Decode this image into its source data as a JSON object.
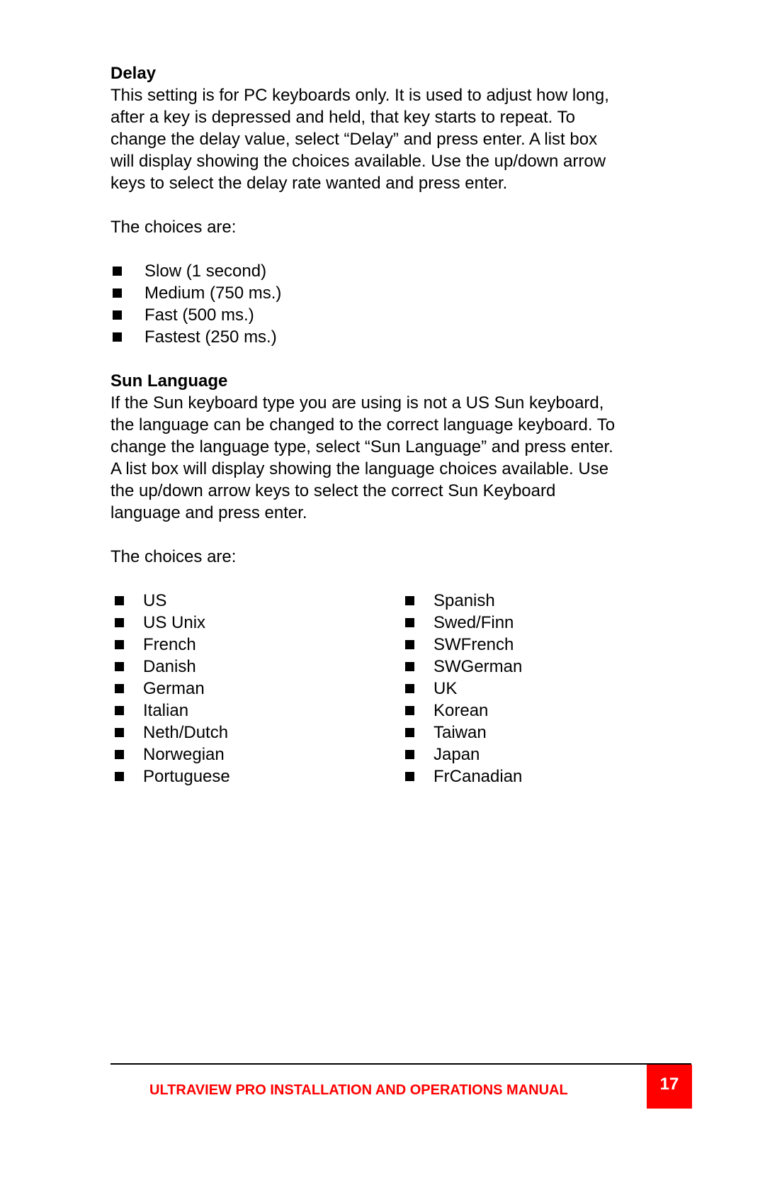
{
  "delay": {
    "heading": "Delay",
    "paragraph_lines": [
      "This setting is for PC keyboards only.  It is used to adjust how long,",
      "after a key is depressed and held, that key starts to repeat. To",
      "change the delay value, select “Delay” and press enter.  A list box",
      "will display showing the choices available.  Use the up/down arrow",
      "keys to select the delay rate wanted and press enter."
    ],
    "choices_intro": "The choices are:",
    "choices": [
      "Slow (1 second)",
      "Medium (750 ms.)",
      "Fast (500 ms.)",
      "Fastest (250 ms.)"
    ]
  },
  "sun_language": {
    "heading": "Sun Language",
    "paragraph_lines": [
      "If the Sun keyboard type you are using is not a US Sun keyboard,",
      "the language can be changed to the correct language keyboard.  To",
      "change the language type, select “Sun Language” and press enter.",
      "A list box will display showing the language choices available.  Use",
      "the up/down arrow keys to select the correct Sun Keyboard",
      "language and press enter."
    ],
    "choices_intro": "The choices are:",
    "choices_left": [
      "US",
      "US Unix",
      "French",
      "Danish",
      "German",
      "Italian",
      "Neth/Dutch",
      "Norwegian",
      "Portuguese"
    ],
    "choices_right": [
      "Spanish",
      "Swed/Finn",
      "SWFrench",
      "SWGerman",
      "UK",
      "Korean",
      "Taiwan",
      "Japan",
      "FrCanadian"
    ]
  },
  "footer": {
    "title": "ULTRAVIEW PRO INSTALLATION AND OPERATIONS MANUAL",
    "page_number": "17",
    "accent_color": "#ff0000"
  }
}
